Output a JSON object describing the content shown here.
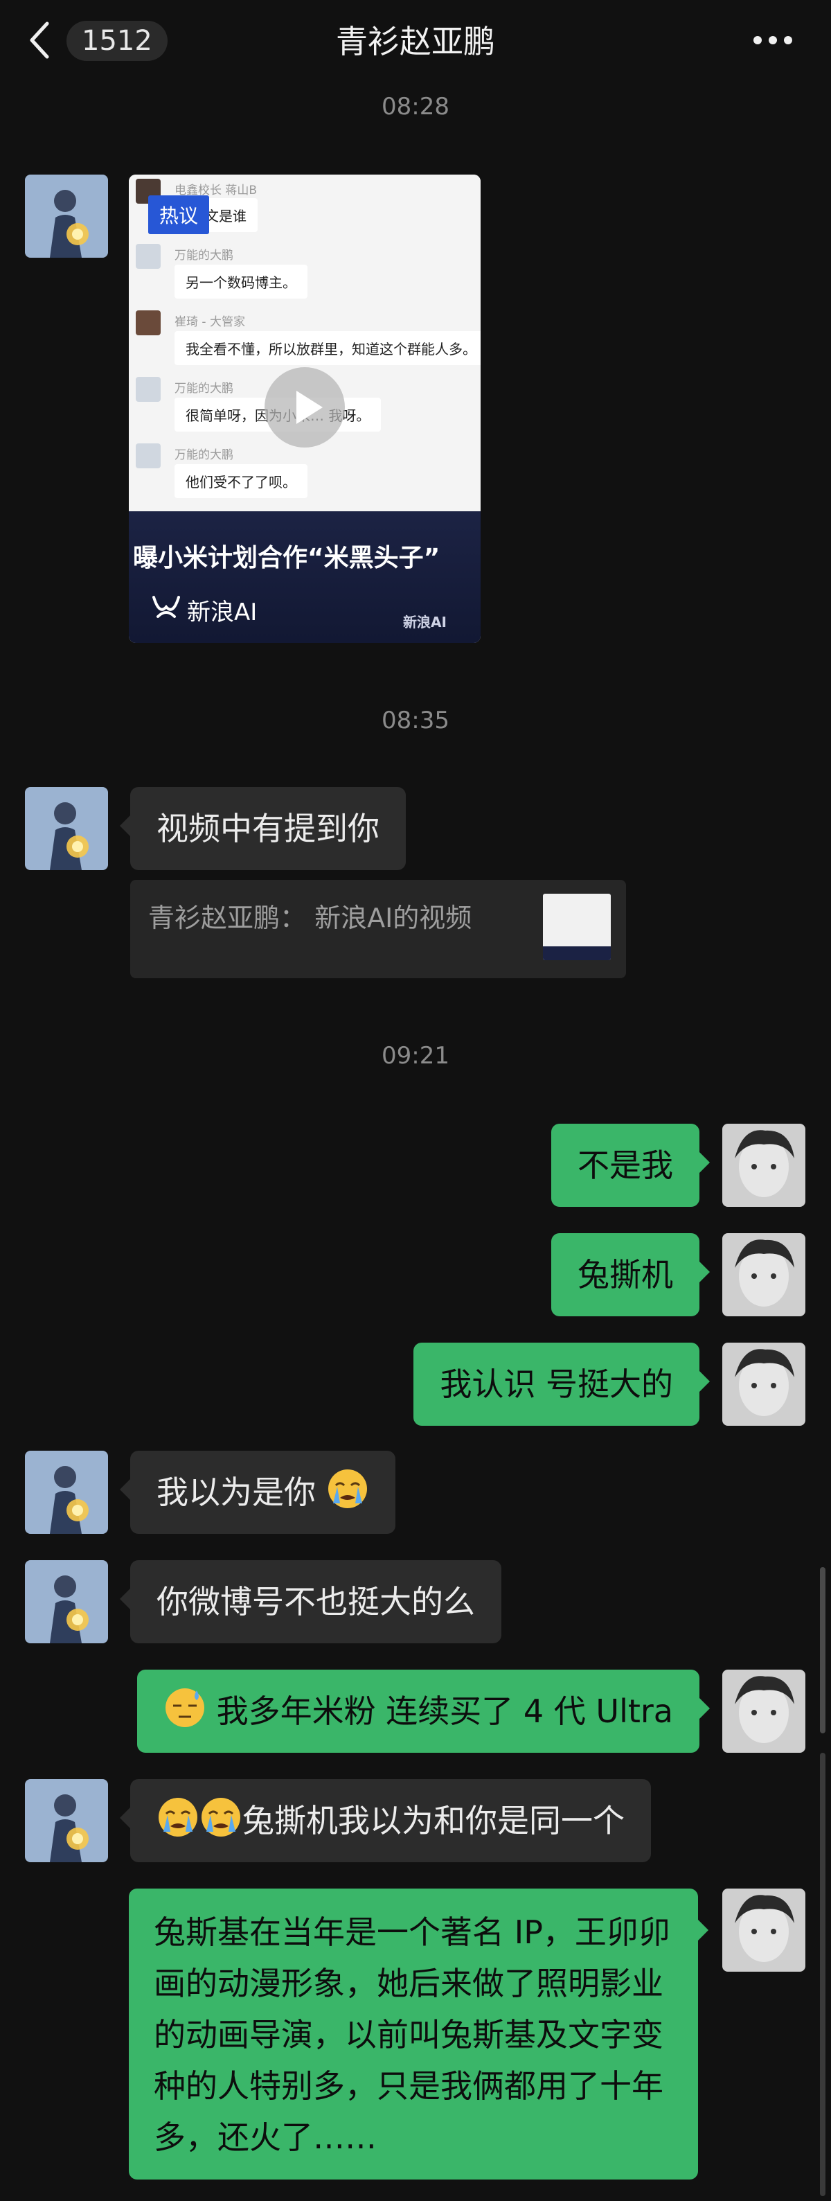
{
  "header": {
    "unread_count": "1512",
    "title": "青衫赵亚鹏"
  },
  "messages": {
    "time1": "08:28",
    "video": {
      "hot_label": "热议",
      "chat_rows": [
        {
          "name": "电鑫校长 蒋山B",
          "text": "文是谁"
        },
        {
          "name": "万能的大鹏",
          "text": "另一个数码博主。"
        },
        {
          "name": "崔琦 - 大管家",
          "text": "我全看不懂，所以放群里，知道这个群能人多。"
        },
        {
          "name": "万能的大鹏",
          "text": "很简单呀，因为小米… 我呀。"
        },
        {
          "name": "万能的大鹏",
          "text": "他们受不了了呗。"
        }
      ],
      "headline": "曝小米计划合作“米黑头子”",
      "brand": "新浪AI",
      "corner_brand": "新浪AI"
    },
    "time2": "08:35",
    "msg_video_mention": "视频中有提到你",
    "quote_text": "青衫赵亚鹏：  新浪AI的视频",
    "time3": "09:21",
    "msg_not_me": "不是我",
    "msg_tuosiji": "兔撕机",
    "msg_i_know": "我认识 号挺大的",
    "msg_thought_you": "我以为是你",
    "msg_weibo": "你微博号不也挺大的么",
    "msg_mifan": "我多年米粉 连续买了 4 代 Ultra",
    "msg_same_person": "兔撕机我以为和你是同一个",
    "msg_long": "兔斯基在当年是一个著名 IP，王卯卯画的动漫形象，她后来做了照明影业的动画导演，以前叫兔斯基及文字变种的人特别多，只是我俩都用了十年多，还火了……"
  },
  "icons": {
    "back": "chevron-left-icon",
    "more": "more-dots-icon",
    "play": "play-icon",
    "emoji_cry": "loudly-crying-emoji-icon",
    "emoji_sweat": "sweat-smile-emoji-icon"
  },
  "colors": {
    "background": "#111111",
    "green_bubble": "#3ab669",
    "gray_bubble": "#2c2c2c"
  }
}
